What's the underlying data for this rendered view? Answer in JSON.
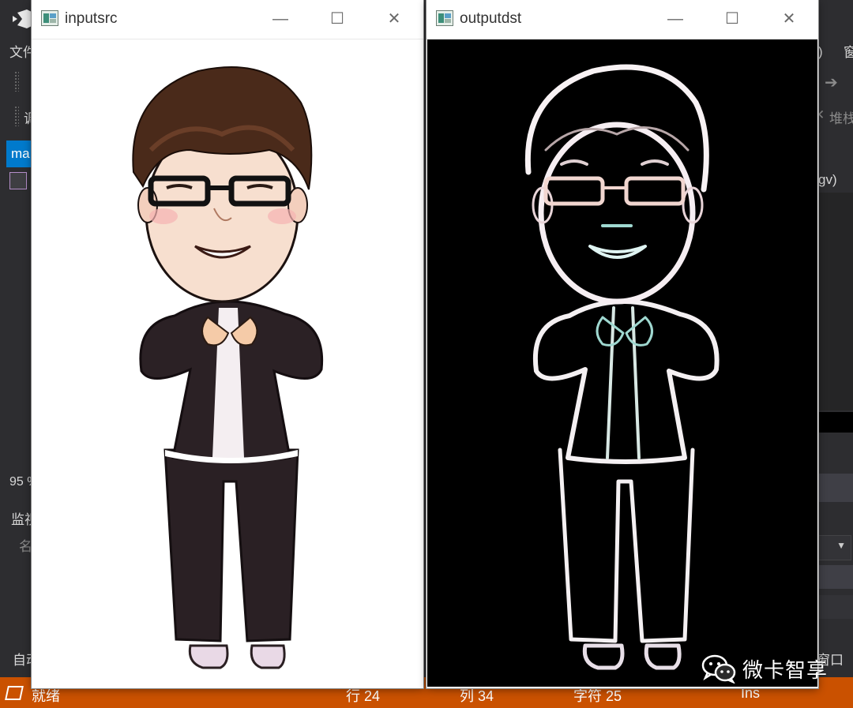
{
  "ide": {
    "menu_left": "文件",
    "menu_right_paren": ")",
    "menu_right_partial": "窗",
    "toolbar_partial": "调",
    "stack_label": "堆栈",
    "doc_tab_partial": "ma",
    "signature_partial": "gv)",
    "zoom_partial": "95 %",
    "watch_label_partial": "监视",
    "name_col_partial": "名",
    "auto_tab_partial": "自动",
    "window_tab_partial": "窗口"
  },
  "status": {
    "ready": "就绪",
    "line": "行 24",
    "col": "列 34",
    "char": "字符 25",
    "mode": "Ins"
  },
  "windows": {
    "input": {
      "title": "inputsrc"
    },
    "output": {
      "title": "outputdst"
    }
  },
  "controls": {
    "minimize": "—",
    "maximize": "☐",
    "close": "✕"
  },
  "watermark": {
    "text": "微卡智享",
    "icon": "wechat-icon"
  },
  "colors": {
    "status_bar": "#ca5100",
    "ide_bg": "#2d2d30",
    "accent": "#007acc"
  }
}
